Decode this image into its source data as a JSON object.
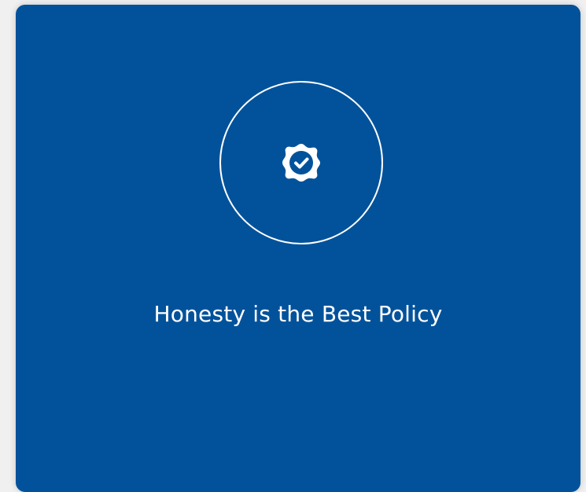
{
  "card": {
    "title": "Honesty is the Best Policy",
    "icon": "verified-badge-icon",
    "background_color": "#02529b",
    "accent_color": "#ffffff"
  }
}
